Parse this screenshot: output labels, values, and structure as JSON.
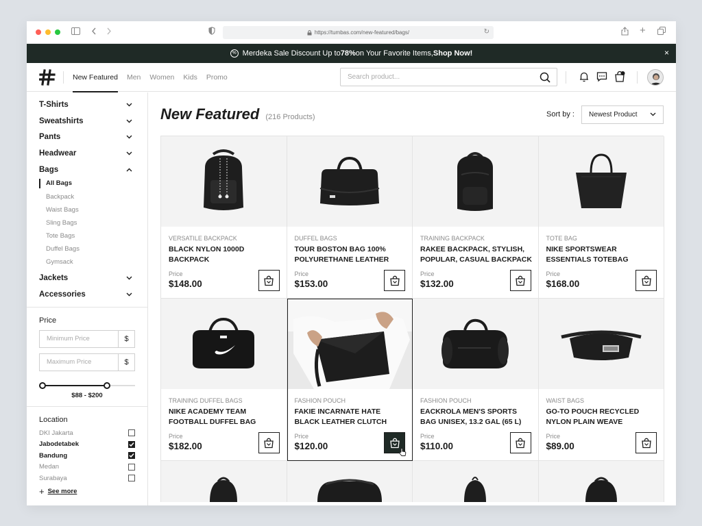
{
  "browser": {
    "url": "https://tumbas.com/new-featured/bags/"
  },
  "banner": {
    "text_prefix": "Merdeka Sale Discount Up to ",
    "text_pct": "78%",
    "text_mid": " on Your Favorite Items, ",
    "cta": "Shop Now!",
    "close": "×"
  },
  "header": {
    "nav": [
      "New Featured",
      "Men",
      "Women",
      "Kids",
      "Promo"
    ],
    "active_nav": "New Featured",
    "search_placeholder": "Search product..."
  },
  "sidebar": {
    "categories_top": [
      {
        "label": "T-Shirts",
        "chevron": "⌄"
      },
      {
        "label": "Sweatshirts",
        "chevron": "⌄"
      },
      {
        "label": "Pants",
        "chevron": "⌄"
      },
      {
        "label": "Headwear",
        "chevron": "⌄"
      },
      {
        "label": "Bags",
        "chevron": "⌃"
      }
    ],
    "bag_subcategories": [
      "All Bags",
      "Backpack",
      "Waist Bags",
      "Sling Bags",
      "Tote Bags",
      "Duffel Bags",
      "Gymsack"
    ],
    "active_subcategory": "All Bags",
    "categories_bottom": [
      {
        "label": "Jackets",
        "chevron": "⌄"
      },
      {
        "label": "Accessories",
        "chevron": "⌄"
      }
    ],
    "price": {
      "title": "Price",
      "min_placeholder": "Minimum Price",
      "max_placeholder": "Maximum Price",
      "currency_symbol": "$",
      "range_label": "$88 - $200",
      "slider_low_fraction": 0.0,
      "slider_high_fraction": 0.72
    },
    "location": {
      "title": "Location",
      "items": [
        {
          "label": "DKI Jakarta",
          "checked": false
        },
        {
          "label": "Jabodetabek",
          "checked": true
        },
        {
          "label": "Bandung",
          "checked": true
        },
        {
          "label": "Medan",
          "checked": false
        },
        {
          "label": "Surabaya",
          "checked": false
        }
      ],
      "see_more": "See more"
    }
  },
  "main": {
    "title": "New Featured",
    "count": "(216 Products)",
    "sort_label": "Sort by :",
    "sort_value": "Newest Product",
    "price_label": "Price",
    "products": [
      {
        "type": "VERSATILE BACKPACK",
        "name": "BLACK NYLON 1000D BACKPACK",
        "price": "$148.00",
        "icon": "backpack"
      },
      {
        "type": "DUFFEL BAGS",
        "name": "TOUR BOSTON BAG 100% POLYURETHANE LEATHER",
        "price": "$153.00",
        "icon": "boston"
      },
      {
        "type": "TRAINING BACKPACK",
        "name": "RAKEE BACKPACK, STYLISH, POPULAR, CASUAL BACKPACK",
        "price": "$132.00",
        "icon": "backpack2"
      },
      {
        "type": "TOTE BAG",
        "name": "NIKE SPORTSWEAR ESSENTIALS TOTEBAG",
        "price": "$168.00",
        "icon": "tote"
      },
      {
        "type": "TRAINING DUFFEL BAGS",
        "name": "NIKE ACADEMY TEAM FOOTBALL DUFFEL BAG",
        "price": "$182.00",
        "icon": "duffel"
      },
      {
        "type": "FASHION POUCH",
        "name": "FAKIE INCARNATE HATE BLACK LEATHER CLUTCH",
        "price": "$120.00",
        "icon": "clutch",
        "selected": true
      },
      {
        "type": "FASHION POUCH",
        "name": "EACKROLA MEN'S SPORTS BAG UNISEX, 13.2 GAL (65 L)",
        "price": "$110.00",
        "icon": "sportsbag"
      },
      {
        "type": "WAIST BAGS",
        "name": "GO-TO POUCH RECYCLED NYLON PLAIN WEAVE",
        "price": "$89.00",
        "icon": "waist"
      }
    ],
    "partial_row_icons": [
      "backpack-partial",
      "sling-partial",
      "gymsack-partial",
      "backpack-partial-2"
    ]
  },
  "colors": {
    "banner_bg": "#1f2a26",
    "accent": "#1c1c1c",
    "muted": "#8b8b8b"
  }
}
